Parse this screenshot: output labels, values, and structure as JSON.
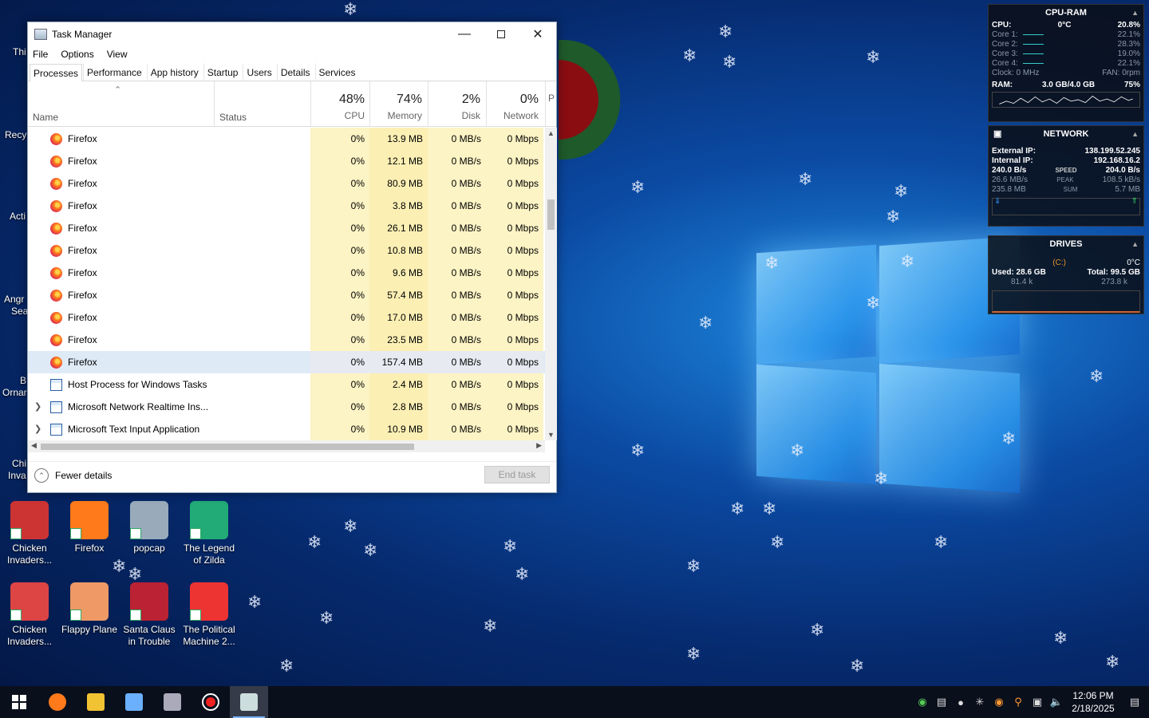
{
  "desktop": {
    "peek_labels": [
      "Thi",
      "Recy",
      "Acti",
      "Angr",
      "Sea",
      "B",
      "Ornar",
      "Chi",
      "Inva"
    ],
    "icons_row1": [
      {
        "label": "Chicken Invaders...",
        "icon": "chicken-invaders-icon",
        "color": "#c33"
      },
      {
        "label": "Firefox",
        "icon": "firefox-icon",
        "color": "#ff7a1a"
      },
      {
        "label": "popcap",
        "icon": "popcap-icon",
        "color": "#9ab"
      },
      {
        "label": "The Legend of Zilda",
        "icon": "zilda-icon",
        "color": "#2a7"
      }
    ],
    "icons_row2": [
      {
        "label": "Chicken Invaders...",
        "icon": "chicken-invaders-icon",
        "color": "#d44"
      },
      {
        "label": "Flappy Plane",
        "icon": "flappy-plane-icon",
        "color": "#e96"
      },
      {
        "label": "Santa Claus in Trouble",
        "icon": "santa-icon",
        "color": "#b23"
      },
      {
        "label": "The Political Machine 2...",
        "icon": "political-machine-icon",
        "color": "#e33"
      }
    ]
  },
  "task_manager": {
    "title": "Task Manager",
    "menu": [
      "File",
      "Options",
      "View"
    ],
    "tabs": [
      "Processes",
      "Performance",
      "App history",
      "Startup",
      "Users",
      "Details",
      "Services"
    ],
    "active_tab": "Processes",
    "columns": {
      "name": "Name",
      "status": "Status",
      "cpu": {
        "pct": "48%",
        "label": "CPU"
      },
      "memory": {
        "pct": "74%",
        "label": "Memory"
      },
      "disk": {
        "pct": "2%",
        "label": "Disk"
      },
      "network": {
        "pct": "0%",
        "label": "Network"
      },
      "power_partial": "P"
    },
    "rows": [
      {
        "name": "Firefox",
        "icon": "firefox",
        "cpu": "0%",
        "mem": "13.9 MB",
        "disk": "0 MB/s",
        "net": "0 Mbps"
      },
      {
        "name": "Firefox",
        "icon": "firefox",
        "cpu": "0%",
        "mem": "12.1 MB",
        "disk": "0 MB/s",
        "net": "0 Mbps"
      },
      {
        "name": "Firefox",
        "icon": "firefox",
        "cpu": "0%",
        "mem": "80.9 MB",
        "disk": "0 MB/s",
        "net": "0 Mbps"
      },
      {
        "name": "Firefox",
        "icon": "firefox",
        "cpu": "0%",
        "mem": "3.8 MB",
        "disk": "0 MB/s",
        "net": "0 Mbps"
      },
      {
        "name": "Firefox",
        "icon": "firefox",
        "cpu": "0%",
        "mem": "26.1 MB",
        "disk": "0 MB/s",
        "net": "0 Mbps"
      },
      {
        "name": "Firefox",
        "icon": "firefox",
        "cpu": "0%",
        "mem": "10.8 MB",
        "disk": "0 MB/s",
        "net": "0 Mbps"
      },
      {
        "name": "Firefox",
        "icon": "firefox",
        "cpu": "0%",
        "mem": "9.6 MB",
        "disk": "0 MB/s",
        "net": "0 Mbps"
      },
      {
        "name": "Firefox",
        "icon": "firefox",
        "cpu": "0%",
        "mem": "57.4 MB",
        "disk": "0 MB/s",
        "net": "0 Mbps"
      },
      {
        "name": "Firefox",
        "icon": "firefox",
        "cpu": "0%",
        "mem": "17.0 MB",
        "disk": "0 MB/s",
        "net": "0 Mbps"
      },
      {
        "name": "Firefox",
        "icon": "firefox",
        "cpu": "0%",
        "mem": "23.5 MB",
        "disk": "0 MB/s",
        "net": "0 Mbps"
      },
      {
        "name": "Firefox",
        "icon": "firefox",
        "cpu": "0%",
        "mem": "157.4 MB",
        "disk": "0 MB/s",
        "net": "0 Mbps",
        "selected": true
      },
      {
        "name": "Host Process for Windows Tasks",
        "icon": "win",
        "cpu": "0%",
        "mem": "2.4 MB",
        "disk": "0 MB/s",
        "net": "0 Mbps"
      },
      {
        "name": "Microsoft Network Realtime Ins...",
        "icon": "win",
        "expandable": true,
        "cpu": "0%",
        "mem": "2.8 MB",
        "disk": "0 MB/s",
        "net": "0 Mbps"
      },
      {
        "name": "Microsoft Text Input Application",
        "icon": "win",
        "expandable": true,
        "cpu": "0%",
        "mem": "10.9 MB",
        "disk": "0 MB/s",
        "net": "0 Mbps"
      }
    ],
    "fewer_details": "Fewer details",
    "end_task": "End task"
  },
  "gadgets": {
    "cpu_ram": {
      "title": "CPU-RAM",
      "cpu_label": "CPU:",
      "cpu_temp": "0°C",
      "cpu_pct": "20.8%",
      "cores": [
        {
          "label": "Core 1:",
          "val": "22.1%"
        },
        {
          "label": "Core 2:",
          "val": "28.3%"
        },
        {
          "label": "Core 3:",
          "val": "19.0%"
        },
        {
          "label": "Core 4:",
          "val": "22.1%"
        }
      ],
      "clock": "Clock: 0 MHz",
      "fan": "FAN: 0rpm",
      "ram_label": "RAM:",
      "ram_val": "3.0 GB/4.0 GB",
      "ram_pct": "75%"
    },
    "network": {
      "title": "NETWORK",
      "external_label": "External IP:",
      "external_ip": "138.199.52.245",
      "internal_label": "Internal IP:",
      "internal_ip": "192.168.16.2",
      "speed_down": "240.0 B/s",
      "speed_label": "SPEED",
      "speed_up": "204.0 B/s",
      "peak_down": "26.6 MB/s",
      "peak_label": "PEAK",
      "peak_up": "108.5 kB/s",
      "sum_down": "235.8 MB",
      "sum_label": "SUM",
      "sum_up": "5.7 MB"
    },
    "drives": {
      "title": "DRIVES",
      "drive": "(C:)",
      "temp": "0°C",
      "used": "Used: 28.6 GB",
      "total": "Total: 99.5 GB",
      "read": "81.4 k",
      "write": "273.8 k"
    }
  },
  "taskbar": {
    "apps": [
      {
        "icon": "start-icon",
        "color": "#fff"
      },
      {
        "icon": "firefox-icon",
        "color": "#ff7a1a"
      },
      {
        "icon": "file-explorer-icon",
        "color": "#f1c232"
      },
      {
        "icon": "people-icon",
        "color": "#6ab0ff"
      },
      {
        "icon": "media-icon",
        "color": "#aab"
      },
      {
        "icon": "record-icon",
        "color": "#e22"
      },
      {
        "icon": "task-manager-icon",
        "color": "#cdd"
      }
    ],
    "time": "12:06 PM",
    "date": "2/18/2025"
  }
}
